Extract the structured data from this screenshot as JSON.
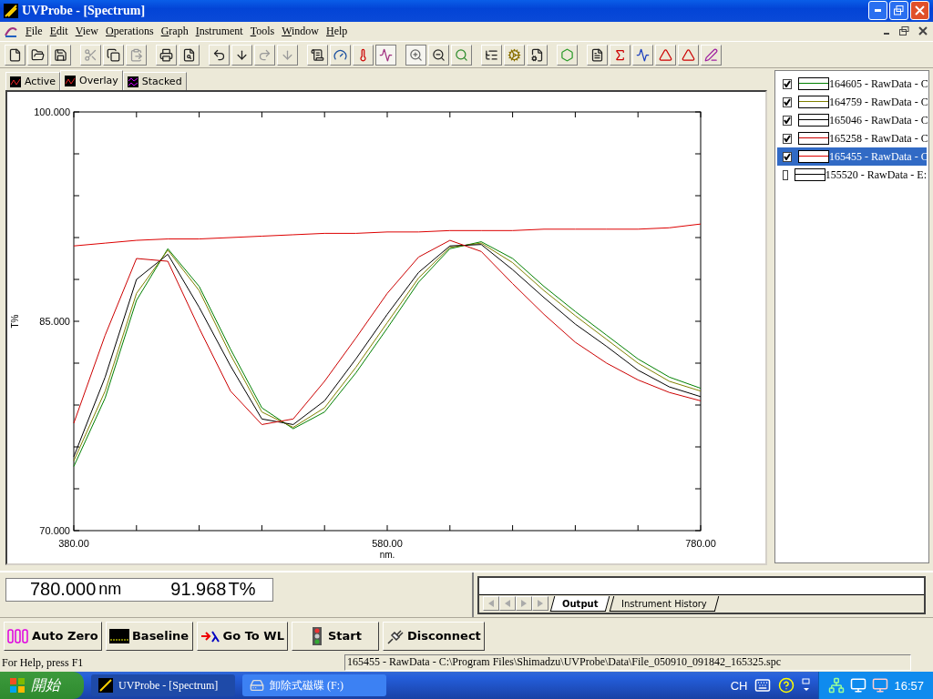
{
  "window": {
    "title": "UVProbe - [Spectrum]"
  },
  "menu": [
    {
      "label": "File"
    },
    {
      "label": "Edit"
    },
    {
      "label": "View"
    },
    {
      "label": "Operations"
    },
    {
      "label": "Graph"
    },
    {
      "label": "Instrument"
    },
    {
      "label": "Tools"
    },
    {
      "label": "Window"
    },
    {
      "label": "Help"
    }
  ],
  "view_tabs": [
    {
      "label": "Active",
      "selected": false
    },
    {
      "label": "Overlay",
      "selected": true
    },
    {
      "label": "Stacked",
      "selected": false
    }
  ],
  "graph": {
    "chart_data": {
      "type": "line",
      "xlabel": "nm.",
      "ylabel": "T%",
      "x": [
        380,
        400,
        420,
        440,
        460,
        480,
        500,
        520,
        540,
        560,
        580,
        600,
        620,
        640,
        660,
        680,
        700,
        720,
        740,
        760,
        780
      ],
      "xlim": [
        380,
        780
      ],
      "ylim": [
        70,
        100
      ],
      "xticks": [
        {
          "value": 380,
          "label": "380.00"
        },
        {
          "value": 580,
          "label": "580.00"
        },
        {
          "value": 780,
          "label": "780.00"
        }
      ],
      "yticks": [
        {
          "value": 70,
          "label": "70.000"
        },
        {
          "value": 85,
          "label": "85.000"
        },
        {
          "value": 100,
          "label": "100.000"
        }
      ],
      "series": [
        {
          "color": "#008000",
          "values": [
            74.6,
            79.5,
            86.5,
            90.2,
            87.5,
            83.0,
            78.8,
            77.3,
            78.5,
            81.3,
            84.5,
            87.8,
            90.2,
            90.7,
            89.5,
            87.5,
            85.7,
            84.0,
            82.3,
            81.0,
            80.2
          ]
        },
        {
          "color": "#808000",
          "values": [
            75.0,
            80.0,
            87.0,
            90.1,
            87.2,
            82.6,
            78.5,
            77.4,
            78.8,
            81.7,
            84.9,
            88.1,
            90.3,
            90.6,
            89.2,
            87.2,
            85.4,
            83.7,
            82.0,
            80.7,
            80.0
          ]
        },
        {
          "color": "#000000",
          "values": [
            75.3,
            81.0,
            88.0,
            89.8,
            86.0,
            81.8,
            78.0,
            77.6,
            79.3,
            82.3,
            85.5,
            88.5,
            90.4,
            90.5,
            88.7,
            86.7,
            84.8,
            83.2,
            81.5,
            80.3,
            79.6
          ]
        },
        {
          "color": "#cc0000",
          "values": [
            77.7,
            84.0,
            89.5,
            89.3,
            84.5,
            80.0,
            77.6,
            78.0,
            80.7,
            83.8,
            87.0,
            89.6,
            90.8,
            90.0,
            87.7,
            85.5,
            83.5,
            82.0,
            80.8,
            79.9,
            79.3
          ]
        },
        {
          "color": "#dd0000",
          "values": [
            90.4,
            90.6,
            90.8,
            90.9,
            90.9,
            91.0,
            91.1,
            91.2,
            91.3,
            91.3,
            91.4,
            91.4,
            91.5,
            91.5,
            91.5,
            91.6,
            91.6,
            91.6,
            91.6,
            91.7,
            91.97
          ]
        }
      ]
    }
  },
  "legend": [
    {
      "label": "164605 - RawData - C",
      "color": "#008000",
      "checked": true,
      "selected": false
    },
    {
      "label": "164759 - RawData - C",
      "color": "#808000",
      "checked": true,
      "selected": false
    },
    {
      "label": "165046 - RawData - C",
      "color": "#000000",
      "checked": true,
      "selected": false
    },
    {
      "label": "165258 - RawData - C",
      "color": "#cc0000",
      "checked": true,
      "selected": false
    },
    {
      "label": "165455 - RawData - C",
      "color": "#dd0000",
      "checked": true,
      "selected": true
    },
    {
      "label": "155520 - RawData - E:",
      "color": "#000000",
      "checked": false,
      "selected": false
    }
  ],
  "readout": {
    "wavelength": "780.000",
    "wavelength_unit": "nm",
    "value": "91.968",
    "value_unit": "T%"
  },
  "output_tabs": [
    {
      "label": "Output",
      "selected": true
    },
    {
      "label": "Instrument History",
      "selected": false
    }
  ],
  "buttons": [
    {
      "kind": "autozero",
      "label": "Auto Zero"
    },
    {
      "kind": "baseline",
      "label": "Baseline"
    },
    {
      "kind": "gotowl",
      "label": "Go To WL"
    },
    {
      "kind": "start",
      "label": "Start"
    },
    {
      "kind": "disconnect",
      "label": "Disconnect"
    }
  ],
  "status_bar": {
    "help": "For Help, press F1",
    "file": "165455 - RawData - C:\\Program Files\\Shimadzu\\UVProbe\\Data\\File_050910_091842_165325.spc"
  },
  "taskbar": {
    "start": "開始",
    "tasks": [
      {
        "label": "UVProbe - [Spectrum]",
        "selected": true
      },
      {
        "label": "卸除式磁碟 (F:)",
        "selected": false
      }
    ],
    "language": "CH",
    "clock": "16:57"
  }
}
